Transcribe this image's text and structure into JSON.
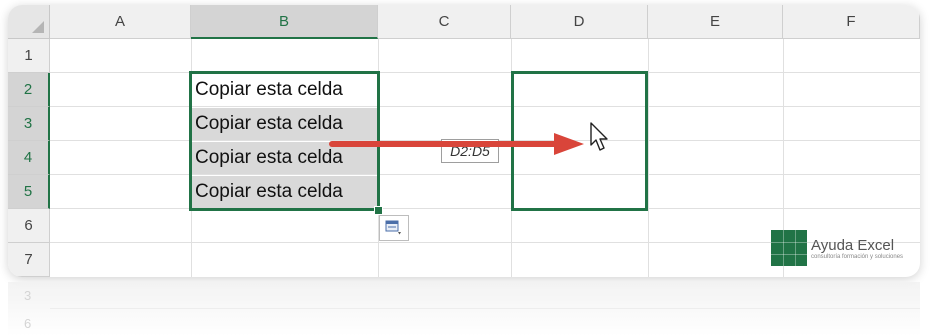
{
  "columns": [
    "A",
    "B",
    "C",
    "D",
    "E",
    "F"
  ],
  "rows": [
    "1",
    "2",
    "3",
    "4",
    "5",
    "6",
    "7"
  ],
  "cells": {
    "B2": "Copiar esta celda",
    "B3": "Copiar esta celda",
    "B4": "Copiar esta celda",
    "B5": "Copiar esta celda"
  },
  "drag_tooltip": "D2:D5",
  "logo": {
    "name": "Ayuda Excel",
    "tagline": "consultoría formación y soluciones"
  },
  "reflection_rows": [
    "3",
    "6"
  ],
  "colors": {
    "excel_green": "#217346",
    "arrow_red": "#d9453a",
    "range_shade": "#d9d9d9"
  },
  "icons": {
    "cursor": "pointer-cursor-icon",
    "paste": "paste-options-icon",
    "arrow": "drag-arrow-icon"
  }
}
